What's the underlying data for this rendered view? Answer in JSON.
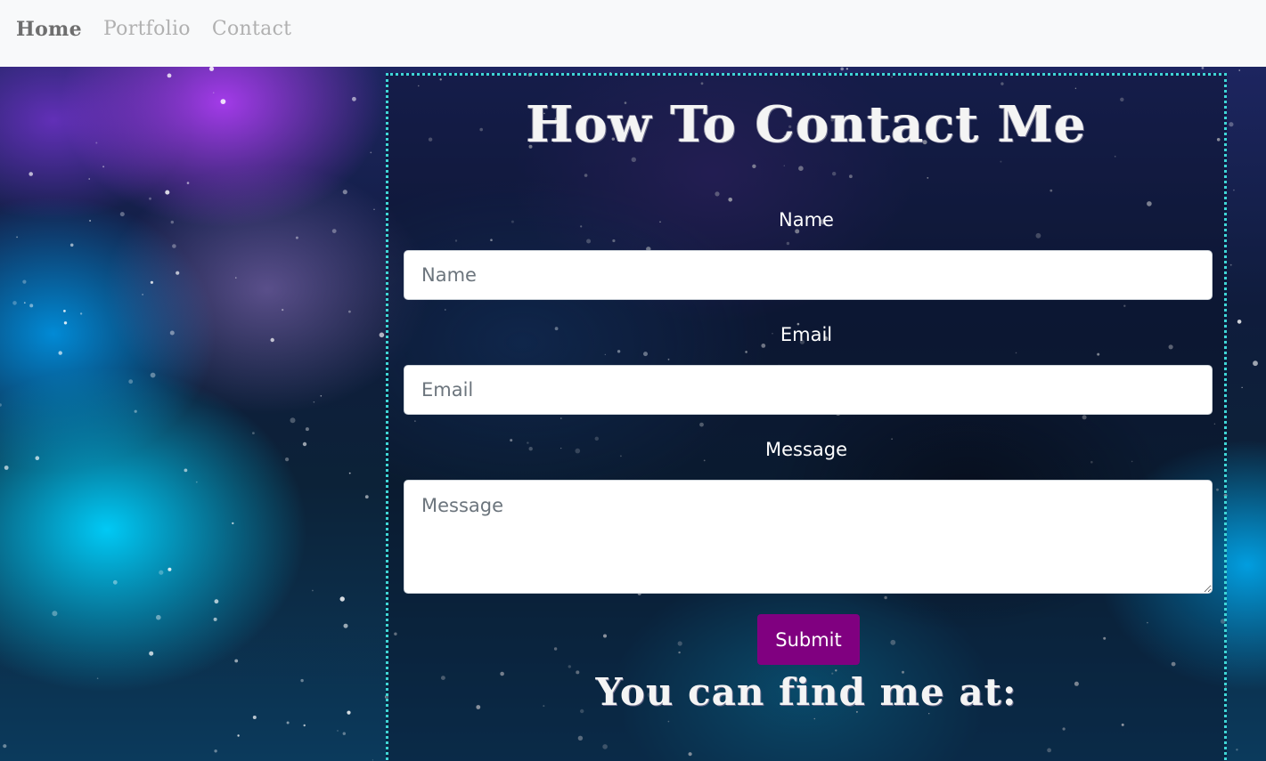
{
  "nav": {
    "items": [
      {
        "label": "Home"
      },
      {
        "label": "Portfolio"
      },
      {
        "label": "Contact"
      }
    ]
  },
  "contact": {
    "title": "How To Contact Me",
    "name_label": "Name",
    "name_placeholder": "Name",
    "email_label": "Email",
    "email_placeholder": "Email",
    "message_label": "Message",
    "message_placeholder": "Message",
    "submit_label": "Submit",
    "find_me_heading": "You can find me at:"
  },
  "colors": {
    "navbar_bg": "#f8f9fa",
    "nav_active": "#6e6e6e",
    "nav_inactive": "#b0b0b0",
    "panel_border": "#3fd6d6",
    "submit_bg": "#800080"
  }
}
